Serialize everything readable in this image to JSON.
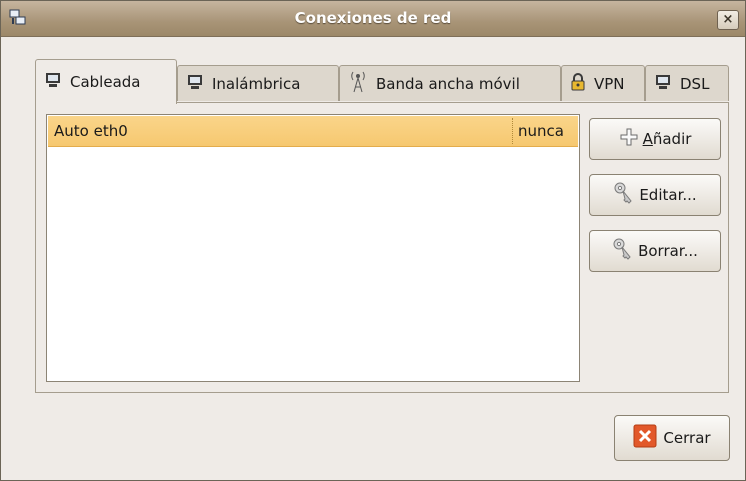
{
  "window": {
    "title": "Conexiones de red",
    "close_glyph": "×"
  },
  "tabs": [
    {
      "label": "Cableada",
      "icon": "wired-icon",
      "active": true
    },
    {
      "label": "Inalámbrica",
      "icon": "wireless-card-icon",
      "active": false
    },
    {
      "label": "Banda ancha móvil",
      "icon": "mobile-antenna-icon",
      "active": false
    },
    {
      "label": "VPN",
      "icon": "lock-icon",
      "active": false
    },
    {
      "label": "DSL",
      "icon": "dsl-icon",
      "active": false
    }
  ],
  "connections": [
    {
      "name": "Auto eth0",
      "last_used": "nunca",
      "selected": true
    }
  ],
  "buttons": {
    "add": {
      "mnemonic": "A",
      "rest": "ñadir",
      "icon": "plus-icon"
    },
    "edit": {
      "label": "Editar...",
      "icon": "keys-icon"
    },
    "delete": {
      "label": "Borrar...",
      "icon": "keys-icon"
    },
    "close": {
      "mnemonic": "C",
      "rest": "errar",
      "icon": "close-x-icon"
    }
  },
  "colors": {
    "selection": "#f6c870",
    "titlebar": "#a89477",
    "close_icon": "#e2582a"
  }
}
